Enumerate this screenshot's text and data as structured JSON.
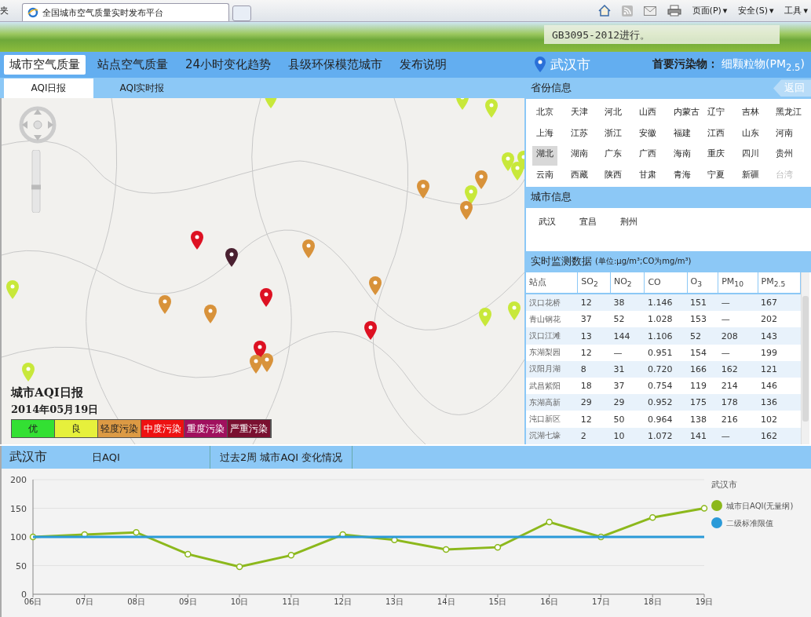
{
  "browser": {
    "left_cut": "夹",
    "tab_title": "全国城市空气质量实时发布平台",
    "toolbar": [
      {
        "label": "页面(P)",
        "caret": "▾"
      },
      {
        "label": "安全(S)",
        "caret": "▾"
      },
      {
        "label": "工具",
        "caret": "▾"
      }
    ]
  },
  "banner": {
    "notice": "GB3095-2012进行。"
  },
  "nav": {
    "tabs": [
      {
        "label": "城市空气质量",
        "selected": true
      },
      {
        "label": "站点空气质量",
        "selected": false
      },
      {
        "label": "24小时变化趋势",
        "selected": false
      },
      {
        "label": "县级环保模范城市",
        "selected": false
      },
      {
        "label": "发布说明",
        "selected": false
      }
    ],
    "city": "武汉市",
    "pollutant_label": "首要污染物：",
    "pollutant": "细颗粒物(PM$_{2.5}$)"
  },
  "subtabs": [
    {
      "label": "AQI日报",
      "selected": true
    },
    {
      "label": "AQI实时报",
      "selected": false
    }
  ],
  "map": {
    "zoom": {
      "level": 0.4
    },
    "title": "城市AQI日报",
    "date": "2014年05月19日",
    "legend": [
      {
        "label": "优",
        "color": "#33e033"
      },
      {
        "label": "良",
        "color": "#e6f03c"
      },
      {
        "label": "轻度污染",
        "color": "#dc9a44"
      },
      {
        "label": "中度污染",
        "color": "#ee1111"
      },
      {
        "label": "重度污染",
        "color": "#a0105e"
      },
      {
        "label": "严重污染",
        "color": "#7a1030"
      }
    ],
    "pins": [
      {
        "color": "#c8e83a"
      },
      {
        "color": "#c8e83a"
      },
      {
        "color": "#c8e83a"
      },
      {
        "color": "#c8e83a"
      },
      {
        "color": "#c8e83a"
      },
      {
        "color": "#c8e83a"
      },
      {
        "color": "#d8923a"
      },
      {
        "color": "#d8923a"
      },
      {
        "color": "#c8e83a"
      },
      {
        "color": "#d8923a"
      },
      {
        "color": "#dd1122"
      },
      {
        "color": "#4a2030"
      },
      {
        "color": "#d8923a"
      },
      {
        "color": "#d8923a"
      },
      {
        "color": "#c8e83a"
      },
      {
        "color": "#d8923a"
      },
      {
        "color": "#d8923a"
      },
      {
        "color": "#dd1122"
      },
      {
        "color": "#dd1122"
      },
      {
        "color": "#c8e83a"
      },
      {
        "color": "#c8e83a"
      },
      {
        "color": "#dd1122"
      },
      {
        "color": "#d8923a"
      },
      {
        "color": "#d8923a"
      },
      {
        "color": "#c8e83a"
      }
    ]
  },
  "provinces": {
    "title": "省份信息",
    "back": "返回",
    "items": [
      {
        "name": "北京",
        "selected": false,
        "disabled": false
      },
      {
        "name": "天津",
        "selected": false,
        "disabled": false
      },
      {
        "name": "河北",
        "selected": false,
        "disabled": false
      },
      {
        "name": "山西",
        "selected": false,
        "disabled": false
      },
      {
        "name": "内蒙古",
        "selected": false,
        "disabled": false
      },
      {
        "name": "辽宁",
        "selected": false,
        "disabled": false
      },
      {
        "name": "吉林",
        "selected": false,
        "disabled": false
      },
      {
        "name": "黑龙江",
        "selected": false,
        "disabled": false
      },
      {
        "name": "上海",
        "selected": false,
        "disabled": false
      },
      {
        "name": "江苏",
        "selected": false,
        "disabled": false
      },
      {
        "name": "浙江",
        "selected": false,
        "disabled": false
      },
      {
        "name": "安徽",
        "selected": false,
        "disabled": false
      },
      {
        "name": "福建",
        "selected": false,
        "disabled": false
      },
      {
        "name": "江西",
        "selected": false,
        "disabled": false
      },
      {
        "name": "山东",
        "selected": false,
        "disabled": false
      },
      {
        "name": "河南",
        "selected": false,
        "disabled": false
      },
      {
        "name": "湖北",
        "selected": true,
        "disabled": false
      },
      {
        "name": "湖南",
        "selected": false,
        "disabled": false
      },
      {
        "name": "广东",
        "selected": false,
        "disabled": false
      },
      {
        "name": "广西",
        "selected": false,
        "disabled": false
      },
      {
        "name": "海南",
        "selected": false,
        "disabled": false
      },
      {
        "name": "重庆",
        "selected": false,
        "disabled": false
      },
      {
        "name": "四川",
        "selected": false,
        "disabled": false
      },
      {
        "name": "贵州",
        "selected": false,
        "disabled": false
      },
      {
        "name": "云南",
        "selected": false,
        "disabled": false
      },
      {
        "name": "西藏",
        "selected": false,
        "disabled": false
      },
      {
        "name": "陕西",
        "selected": false,
        "disabled": false
      },
      {
        "name": "甘肃",
        "selected": false,
        "disabled": false
      },
      {
        "name": "青海",
        "selected": false,
        "disabled": false
      },
      {
        "name": "宁夏",
        "selected": false,
        "disabled": false
      },
      {
        "name": "新疆",
        "selected": false,
        "disabled": false
      },
      {
        "name": "台湾",
        "selected": false,
        "disabled": true
      }
    ]
  },
  "cities": {
    "title": "城市信息",
    "items": [
      "武汉",
      "宜昌",
      "荆州"
    ]
  },
  "monitoring": {
    "title": "实时监测数据",
    "unit": "(单位:μg/m³;CO为mg/m³)",
    "columns": [
      "站点",
      "SO$_{2}$",
      "NO$_{2}$",
      "CO",
      "O$_{3}$",
      "PM$_{10}$",
      "PM$_{2.5}$"
    ],
    "rows": [
      [
        "汉口花桥",
        "12",
        "38",
        "1.146",
        "151",
        "—",
        "167"
      ],
      [
        "青山钢花",
        "37",
        "52",
        "1.028",
        "153",
        "—",
        "202"
      ],
      [
        "汉口江滩",
        "13",
        "144",
        "1.106",
        "52",
        "208",
        "143"
      ],
      [
        "东湖梨园",
        "12",
        "—",
        "0.951",
        "154",
        "—",
        "199"
      ],
      [
        "汉阳月湖",
        "8",
        "31",
        "0.720",
        "166",
        "162",
        "121"
      ],
      [
        "武昌紫阳",
        "18",
        "37",
        "0.754",
        "119",
        "214",
        "146"
      ],
      [
        "东湖高新",
        "29",
        "29",
        "0.952",
        "175",
        "178",
        "136"
      ],
      [
        "沌口新区",
        "12",
        "50",
        "0.964",
        "138",
        "216",
        "102"
      ],
      [
        "沉湖七壕",
        "2",
        "10",
        "1.072",
        "141",
        "—",
        "162"
      ]
    ]
  },
  "trend": {
    "city": "武汉市",
    "metric": "日AQI",
    "title": "过去2周 城市AQI 变化情况",
    "chart_data": {
      "type": "line",
      "title": "武汉市",
      "categories": [
        "06日",
        "07日",
        "08日",
        "09日",
        "10日",
        "11日",
        "12日",
        "13日",
        "14日",
        "15日",
        "16日",
        "17日",
        "18日",
        "19日"
      ],
      "series": [
        {
          "name": "城市日AQI(无量纲)",
          "color": "#8cb81c",
          "marker": "circle",
          "values": [
            100,
            104,
            108,
            70,
            48,
            68,
            104,
            95,
            78,
            82,
            126,
            100,
            134,
            150
          ]
        },
        {
          "name": "二级标准限值",
          "color": "#2a9ad8",
          "marker": "none",
          "values": [
            100,
            100,
            100,
            100,
            100,
            100,
            100,
            100,
            100,
            100,
            100,
            100,
            100,
            100
          ]
        }
      ],
      "legend": "right",
      "ylim": [
        0,
        200
      ],
      "yticks": [
        0,
        50,
        100,
        150,
        200
      ]
    }
  }
}
